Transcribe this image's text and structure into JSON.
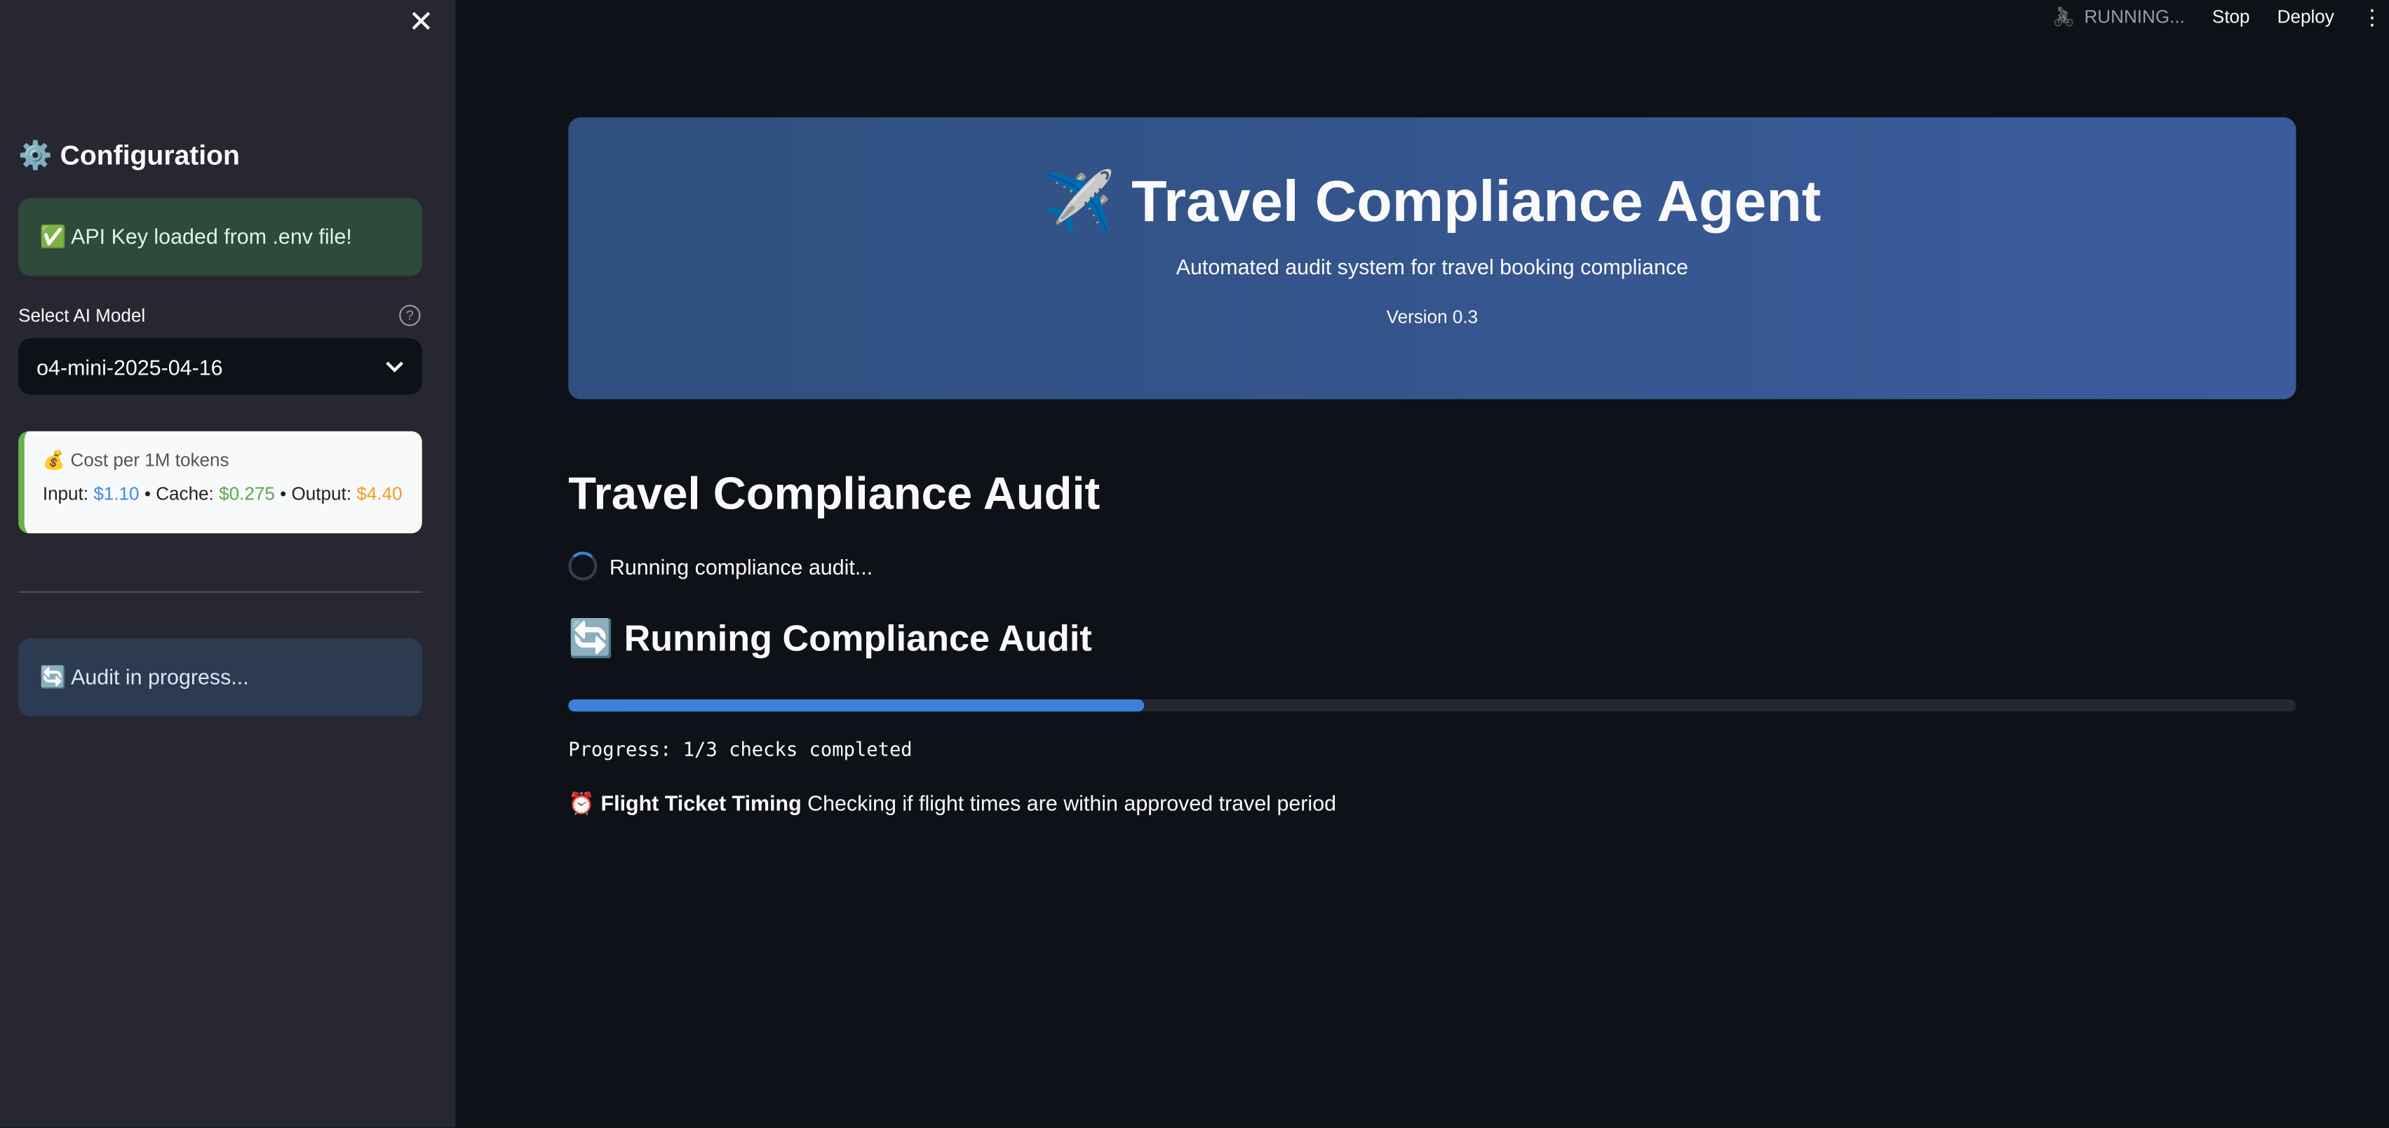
{
  "sidebar": {
    "close_icon": "✕",
    "title_icon": "⚙️",
    "title": "Configuration",
    "api_status": "✅ API Key loaded from .env file!",
    "model_label": "Select AI Model",
    "help_icon": "?",
    "model_value": "o4-mini-2025-04-16",
    "cost": {
      "title": "💰 Cost per 1M tokens",
      "input_label": "Input:",
      "input_value": "$1.10",
      "cache_label": "Cache:",
      "cache_value": "$0.275",
      "output_label": "Output:",
      "output_value": "$4.40",
      "sep": "•"
    },
    "audit_status": "🔄 Audit in progress..."
  },
  "topbar": {
    "status": "RUNNING...",
    "stop": "Stop",
    "deploy": "Deploy",
    "menu": "⋮",
    "status_icon": "🚴"
  },
  "hero": {
    "title": "✈️ Travel Compliance Agent",
    "subtitle": "Automated audit system for travel booking compliance",
    "version": "Version 0.3"
  },
  "main": {
    "title": "Travel Compliance Audit",
    "spinner_text": "Running compliance audit...",
    "section_title": "🔄 Running Compliance Audit",
    "progress_fraction": 0.3333,
    "progress_text": "Progress: 1/3 checks completed",
    "check_icon": "⏰",
    "check_name": "Flight Ticket Timing",
    "check_desc": "Checking if flight times are within approved travel period"
  }
}
